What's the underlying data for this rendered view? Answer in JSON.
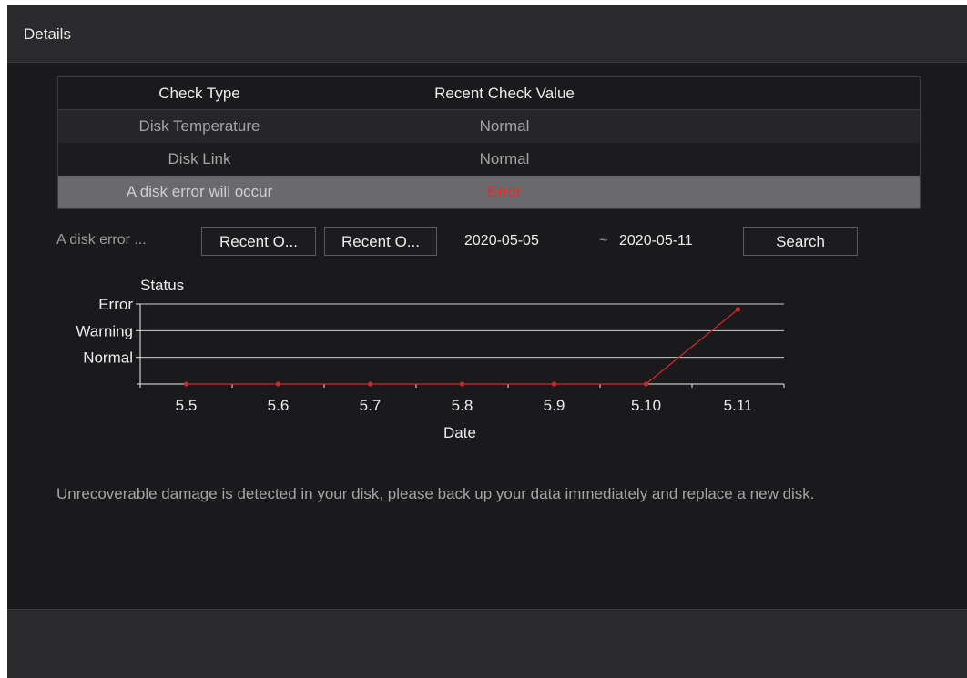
{
  "dialog": {
    "title": "Details"
  },
  "table": {
    "headers": [
      "Check Type",
      "Recent Check Value"
    ],
    "rows": [
      {
        "type": "Disk Temperature",
        "value": "Normal"
      },
      {
        "type": "Disk Link",
        "value": "Normal"
      },
      {
        "type": "A disk error will occur",
        "value": "Error"
      }
    ],
    "selected_index": 2
  },
  "filter": {
    "label": "A disk error ...",
    "recent_button_1": "Recent O...",
    "recent_button_2": "Recent O...",
    "start_date": "2020-05-05",
    "separator": "~",
    "end_date": "2020-05-11",
    "search_label": "Search"
  },
  "chart_data": {
    "type": "line",
    "title": "",
    "ylabel": "Status",
    "xlabel": "Date",
    "categories": [
      "5.5",
      "5.6",
      "5.7",
      "5.8",
      "5.9",
      "5.10",
      "5.11"
    ],
    "y_levels": [
      "Normal",
      "Warning",
      "Error"
    ],
    "series": [
      {
        "values": [
          0,
          0,
          0,
          0,
          0,
          0,
          2.8
        ]
      }
    ],
    "ylim": [
      0,
      3
    ],
    "grid": true,
    "colors": {
      "series": "#cc2a2a",
      "grid": "#cfcfcf",
      "axis": "#ececec"
    }
  },
  "message": "Unrecoverable damage is detected in your disk, please back up your data immediately and replace a new disk.",
  "colors": {
    "background": "#1a1a1c",
    "title_bar": "#2a2a2c",
    "error_text": "#ff2020"
  }
}
